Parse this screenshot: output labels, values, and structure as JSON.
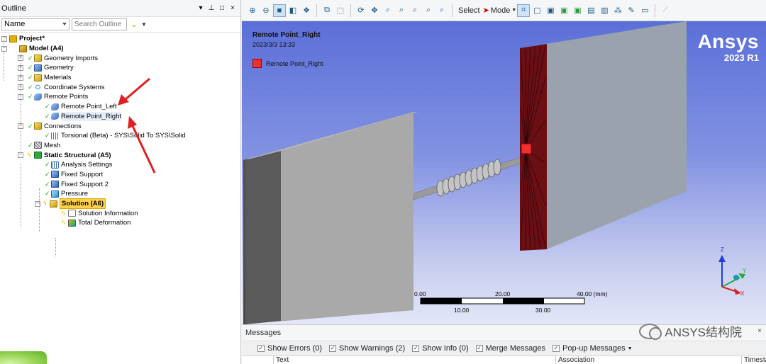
{
  "outline": {
    "title": "Outline",
    "controls": [
      "▾",
      "⊥",
      "□",
      "×"
    ],
    "name_select": "Name",
    "search_placeholder": "Search Outline",
    "tree": [
      {
        "label": "Project*",
        "depth": 0,
        "bold": true,
        "icon": "project-icon"
      },
      {
        "label": "Model (A4)",
        "depth": 1,
        "bold": true,
        "icon": "model-icon"
      },
      {
        "label": "Geometry Imports",
        "depth": 2,
        "icon": "geometry-imports-icon"
      },
      {
        "label": "Geometry",
        "depth": 2,
        "icon": "geometry-icon"
      },
      {
        "label": "Materials",
        "depth": 2,
        "icon": "materials-icon"
      },
      {
        "label": "Coordinate Systems",
        "depth": 2,
        "icon": "coordinate-systems-icon"
      },
      {
        "label": "Remote Points",
        "depth": 2,
        "icon": "remote-points-icon"
      },
      {
        "label": "Remote Point_Left",
        "depth": 3,
        "icon": "remote-point-icon"
      },
      {
        "label": "Remote Point_Right",
        "depth": 3,
        "icon": "remote-point-icon"
      },
      {
        "label": "Connections",
        "depth": 2,
        "icon": "connections-icon"
      },
      {
        "label": "Torsional (Beta) - SYS\\Solid To SYS\\Solid",
        "depth": 3,
        "icon": "spring-icon"
      },
      {
        "label": "Mesh",
        "depth": 2,
        "icon": "mesh-icon"
      },
      {
        "label": "Static Structural (A5)",
        "depth": 2,
        "bold": true,
        "icon": "static-structural-icon"
      },
      {
        "label": "Analysis Settings",
        "depth": 3,
        "icon": "analysis-settings-icon"
      },
      {
        "label": "Fixed Support",
        "depth": 3,
        "icon": "fixed-support-icon"
      },
      {
        "label": "Fixed Support 2",
        "depth": 3,
        "icon": "fixed-support-icon"
      },
      {
        "label": "Pressure",
        "depth": 3,
        "icon": "pressure-icon"
      },
      {
        "label": "Solution (A6)",
        "depth": 3,
        "selected": true,
        "icon": "solution-icon"
      },
      {
        "label": "Solution Information",
        "depth": 4,
        "icon": "solution-information-icon"
      },
      {
        "label": "Total Deformation",
        "depth": 4,
        "icon": "total-deformation-icon"
      }
    ]
  },
  "toolbar": {
    "select_label": "Select",
    "mode_label": "Mode"
  },
  "viewport": {
    "title": "Remote Point_Right",
    "date": "2023/3/3 13:33",
    "legend_label": "Remote Point_Right",
    "legend_color": "#f03030",
    "brand_name": "Ansys",
    "brand_version": "2023 R1",
    "scale_top": [
      "0.00",
      "20.00",
      "40.00 (mm)"
    ],
    "scale_bottom": [
      "10.00",
      "30.00"
    ],
    "triad": {
      "z": "Z",
      "y": "Y",
      "x": "X"
    }
  },
  "messages": {
    "title": "Messages",
    "show_errors": "Show Errors",
    "errors_count": "(0)",
    "show_warnings": "Show Warnings",
    "warnings_count": "(2)",
    "show_info": "Show Info",
    "info_count": "(0)",
    "merge_messages": "Merge Messages",
    "popup_messages": "Pop-up Messages",
    "col_text": "Text",
    "col_association": "Association",
    "col_timestamp": "Timesta"
  },
  "watermark": "ANSYS结构院",
  "colors": {
    "accent_selection": "#ffd24d",
    "annotation_arrow": "#e02020",
    "fixed_face": "#6a0f14"
  }
}
